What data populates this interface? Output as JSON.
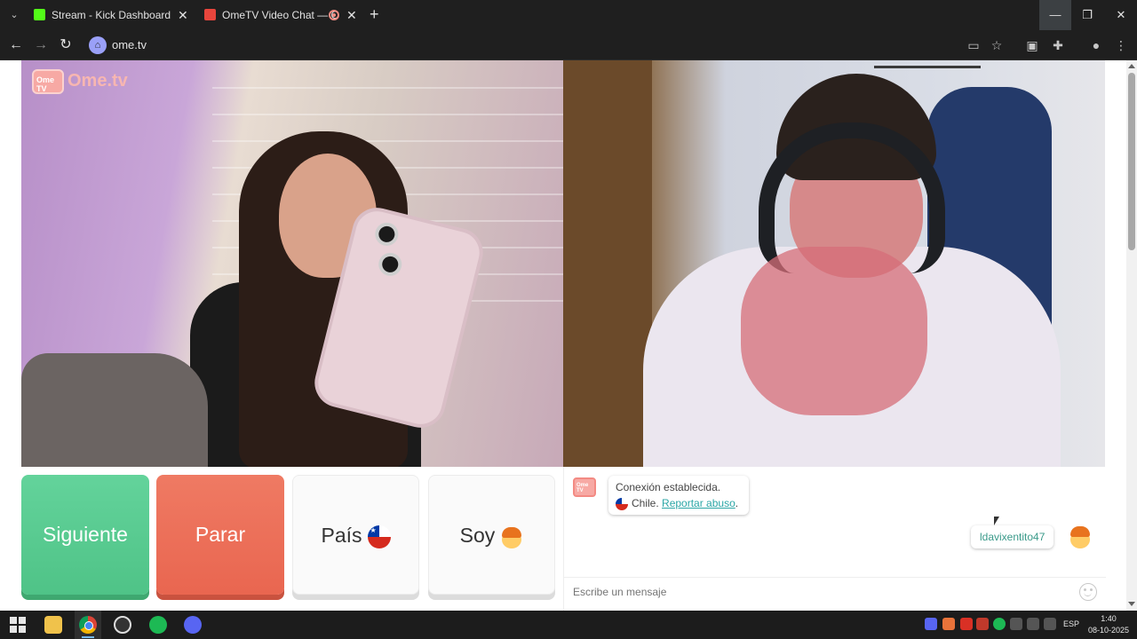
{
  "browser": {
    "tabs": [
      {
        "title": "Stream - Kick Dashboard",
        "active": false
      },
      {
        "title": "OmeTV Video Chat — Ome",
        "active": true
      }
    ],
    "url": "ome.tv"
  },
  "site": {
    "logo_text": "Ome.tv",
    "logo_badge": "Ome TV"
  },
  "controls": {
    "next_label": "Siguiente",
    "stop_label": "Parar",
    "country_label": "País",
    "me_label": "Soy"
  },
  "chat": {
    "system_line1": "Conexión establecida.",
    "country": "Chile.",
    "report_link": "Reportar abuso",
    "report_suffix": ".",
    "user_message": "ldavixentito47",
    "input_placeholder": "Escribe un mensaje"
  },
  "taskbar": {
    "language": "ESP",
    "time": "1:40",
    "date": "08-10-2025"
  },
  "colors": {
    "next_button": "#4fc387",
    "stop_button": "#e96650",
    "link": "#2aa6a6"
  }
}
